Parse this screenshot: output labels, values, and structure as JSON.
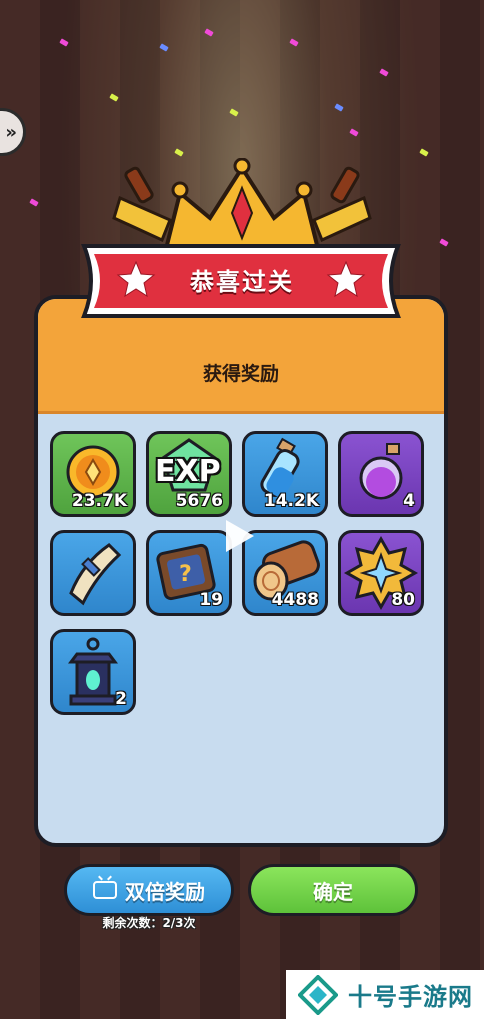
{
  "header": {
    "title": "恭喜过关",
    "subtitle": "获得奖励"
  },
  "rewards": [
    {
      "name": "coin",
      "count": "23.7K",
      "bg": "green"
    },
    {
      "name": "exp",
      "label": "EXP",
      "count": "5676",
      "bg": "green"
    },
    {
      "name": "blue-potion",
      "count": "14.2K",
      "bg": "blue"
    },
    {
      "name": "purple-potion",
      "count": "4",
      "bg": "purple"
    },
    {
      "name": "scroll",
      "count": "",
      "bg": "blue"
    },
    {
      "name": "mystery-chest",
      "count": "19",
      "bg": "blue"
    },
    {
      "name": "wood-log",
      "count": "4488",
      "bg": "blue"
    },
    {
      "name": "star-badge",
      "count": "80",
      "bg": "purple"
    },
    {
      "name": "lantern",
      "count": "2",
      "bg": "blue"
    }
  ],
  "buttons": {
    "double_label": "双倍奖励",
    "confirm_label": "确定",
    "remaining_text": "剩余次数：2/3次"
  },
  "watermark": {
    "text": "十号手游网"
  },
  "colors": {
    "banner_red": "#e0303f",
    "panel_orange": "#f3a43a",
    "panel_blue": "#c8dcef",
    "confirm_green": "#6bd145",
    "double_blue": "#3ea0e4"
  }
}
